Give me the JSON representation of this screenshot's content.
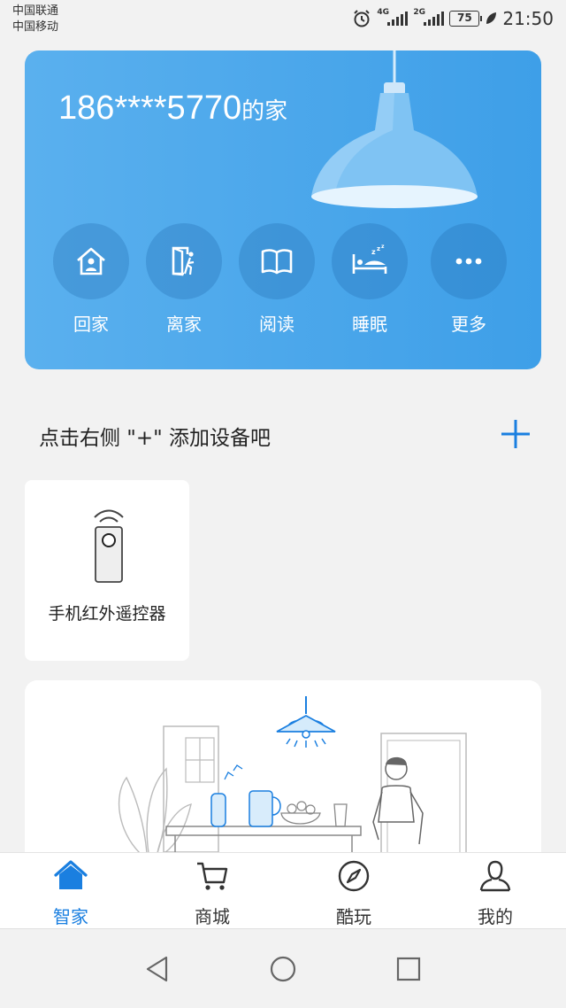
{
  "status": {
    "carrier1": "中国联通",
    "carrier2": "中国移动",
    "net1": "4G",
    "net2": "2G",
    "battery": "75",
    "time": "21:50"
  },
  "hero": {
    "home_name": "186****5770",
    "home_suffix": "的家",
    "scenes": [
      {
        "label": "回家",
        "icon": "home-person-icon"
      },
      {
        "label": "离家",
        "icon": "exit-door-icon"
      },
      {
        "label": "阅读",
        "icon": "book-icon"
      },
      {
        "label": "睡眠",
        "icon": "sleep-bed-icon"
      },
      {
        "label": "更多",
        "icon": "more-dots-icon"
      }
    ]
  },
  "add_device": {
    "hint": "点击右侧 \"+\" 添加设备吧",
    "icon": "plus-icon"
  },
  "devices": [
    {
      "name": "手机红外遥控器",
      "icon": "ir-remote-icon"
    }
  ],
  "tabs": [
    {
      "label": "智家",
      "icon": "home-icon",
      "active": true
    },
    {
      "label": "商城",
      "icon": "cart-icon",
      "active": false
    },
    {
      "label": "酷玩",
      "icon": "compass-icon",
      "active": false
    },
    {
      "label": "我的",
      "icon": "user-icon",
      "active": false
    }
  ],
  "colors": {
    "accent": "#1a7fe0",
    "hero_start": "#5ab0ee",
    "hero_end": "#3e9fe8"
  }
}
